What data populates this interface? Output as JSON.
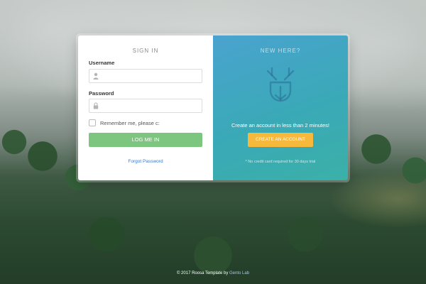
{
  "signin": {
    "heading": "SIGN IN",
    "username_label": "Username",
    "username_value": "",
    "password_label": "Password",
    "password_value": "",
    "remember_label": "Remember me, please c:",
    "remember_checked": false,
    "login_button": "LOG ME IN",
    "forgot_link": "Forgot Password",
    "username_icon": "user-icon",
    "password_icon": "lock-icon"
  },
  "signup": {
    "heading": "NEW HERE?",
    "logo_icon": "deer-icon",
    "tagline": "Create an account in less than 2 minutes!",
    "create_button": "CREATE AN ACCOUNT",
    "note": "* No credit card required for 30 days trial"
  },
  "footer": {
    "prefix": "© 2017 Roosa Template by ",
    "link": "Gento Lab"
  },
  "colors": {
    "login_button": "#7cc67f",
    "create_button": "#f6b93b",
    "panel_gradient_start": "#4aa3cf",
    "panel_gradient_end": "#3bb0a8",
    "link": "#3a78c8"
  }
}
